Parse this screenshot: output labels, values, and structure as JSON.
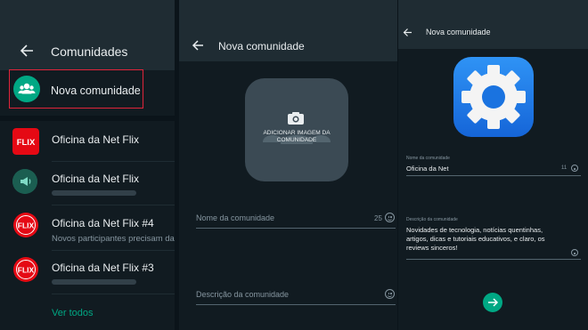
{
  "panel1": {
    "title": "Comunidades",
    "new_community": "Nova comunidade",
    "items": [
      {
        "title": "Oficina da Net Flix",
        "subtitle": ""
      },
      {
        "title": "Oficina da Net Flix",
        "subtitle": ""
      },
      {
        "title": "Oficina da Net Flix #4",
        "subtitle": "Novos participantes precisam da"
      },
      {
        "title": "Oficina da Net Flix #3",
        "subtitle": ""
      }
    ],
    "see_all": "Ver todos",
    "flix_badge_text": "FLIX",
    "colors": {
      "accent": "#00a884",
      "highlight": "#e0243a",
      "flix_red": "#e50914"
    }
  },
  "panel2": {
    "title": "Nova comunidade",
    "photo_text": "Adicionar imagem da comunidade",
    "name_placeholder": "Nome da comunidade",
    "name_counter": "25",
    "desc_placeholder": "Descrição da comunidade"
  },
  "panel3": {
    "title": "Nova comunidade",
    "name_label": "Nome da comunidade",
    "name_value": "Oficina da Net",
    "name_counter": "11",
    "desc_label": "Descrição da comunidade",
    "desc_value": "Novidades de tecnologia, notícias quentinhas, artigos, dicas e tutoriais educativos, e claro, os reviews sinceros!"
  }
}
